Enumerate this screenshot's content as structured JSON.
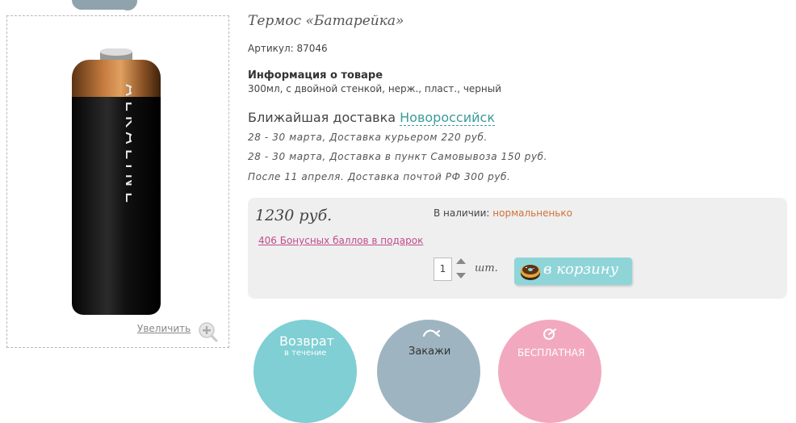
{
  "product": {
    "title": "Термос «Батарейка»",
    "sku": "Артикул: 87046",
    "info_heading": "Информация о товаре",
    "info_text": "300мл, с двойной стенкой, нерж., пласт., черный",
    "image_text": "ALKALINE",
    "zoom_label": "Увеличить"
  },
  "delivery": {
    "heading": "Ближайшая доставка",
    "city": "Новороссийск",
    "lines": [
      "28 - 30 марта, Доставка курьером 220 руб.",
      "28 - 30 марта, Доставка в пункт Самовывоза 150 руб.",
      "После 11 апреля. Доставка почтой РФ 300 руб."
    ]
  },
  "purchase": {
    "price": "1230 руб.",
    "stock_label": "В наличии:",
    "stock_value": "нормальненько",
    "bonus": "406 Бонусных баллов в подарок",
    "quantity": "1",
    "unit": "шт.",
    "cart_button": "в корзину"
  },
  "badges": [
    {
      "title": "Возврат",
      "subtitle": "в течение"
    },
    {
      "title": "Закажи"
    },
    {
      "title": "БЕСПЛАТНАЯ"
    }
  ],
  "colors": {
    "accent_teal": "#3a9c9a",
    "stock_orange": "#d07238",
    "bonus_pink": "#c04c8c",
    "cart_button": "#8fd5d8"
  },
  "icons": [
    "cloud-icon",
    "zoom-plus-icon",
    "donut-cart-icon",
    "arrow-up-icon",
    "arrow-down-icon"
  ]
}
